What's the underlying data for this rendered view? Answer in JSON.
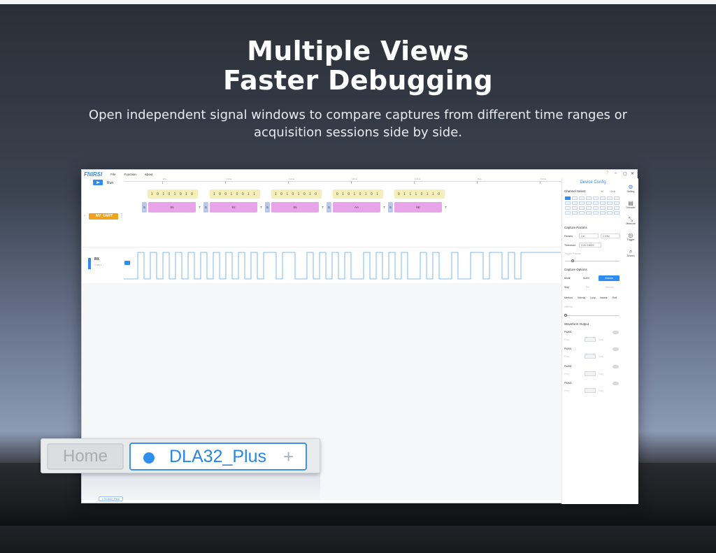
{
  "hero": {
    "title_line1": "Multiple Views",
    "title_line2": "Faster Debugging",
    "subtitle": "Open independent signal windows to compare captures from different time ranges or acquisition sessions side by side."
  },
  "app": {
    "logo": "FNIRSI",
    "menu": [
      "File",
      "Function",
      "About"
    ],
    "run_label": "Run",
    "ruler_labels": [
      "0ms",
      "1.6ms",
      "3.2ms",
      "4.8ms",
      "6.4ms",
      "8ms",
      "9.6ms"
    ],
    "decoder": {
      "name": "MY_UART",
      "bit_groups": [
        "1 0 1 0 1 0 1 0",
        "1 0 0 1 0 0 1 1",
        "1 0 1 0 1 0 1 0",
        "0 1 0 1 0 1 0 1",
        "0 1 1 1 0 1 1 0"
      ],
      "frames": [
        {
          "start": "S",
          "data": "55",
          "stop": "T"
        },
        {
          "start": "S",
          "data": "92",
          "stop": "T"
        },
        {
          "start": "S",
          "data": "55",
          "stop": "T"
        },
        {
          "start": "S",
          "data": "AA",
          "stop": "T"
        },
        {
          "start": "S",
          "data": "6E",
          "stop": "T"
        }
      ]
    },
    "channel": {
      "name": "RX",
      "sub": "1 ms  1  ↓"
    },
    "bottom_tab": "• DLA32_Plus"
  },
  "panel": {
    "title": "Device Config",
    "channel_select": "Channel Select",
    "all": "All",
    "clear": "Clear",
    "capture_params": "Capture Params",
    "params_label": "Params",
    "params_val1": "1 s",
    "params_val2": "1 GHz",
    "threshold_label": "Threshold",
    "threshold_val": "3.3V CMOS",
    "trigger_position": "Trigger Position",
    "capture_options": "Capture Options",
    "mode_label": "Mode",
    "mode_buffer": "Buffer",
    "mode_stream": "Stream",
    "stop_label": "Stop",
    "stop_a": "Fill",
    "stop_b": "Manual",
    "method_label": "Method",
    "methods": [
      "Normal",
      "Loop",
      "Instant",
      "Roll"
    ],
    "interval_label": "Interval",
    "waveform_output": "Waveform Output",
    "pwm": [
      "PWM0",
      "PWM1",
      "PWM2",
      "PWM3"
    ],
    "freq_label": "Freq",
    "duty_label": "Duty"
  },
  "tools": [
    "Setting",
    "Decoder",
    "Measure",
    "Trigger",
    "Search"
  ],
  "zoom_tabs": {
    "home": "Home",
    "device": "DLA32_Plus",
    "add": "+"
  }
}
